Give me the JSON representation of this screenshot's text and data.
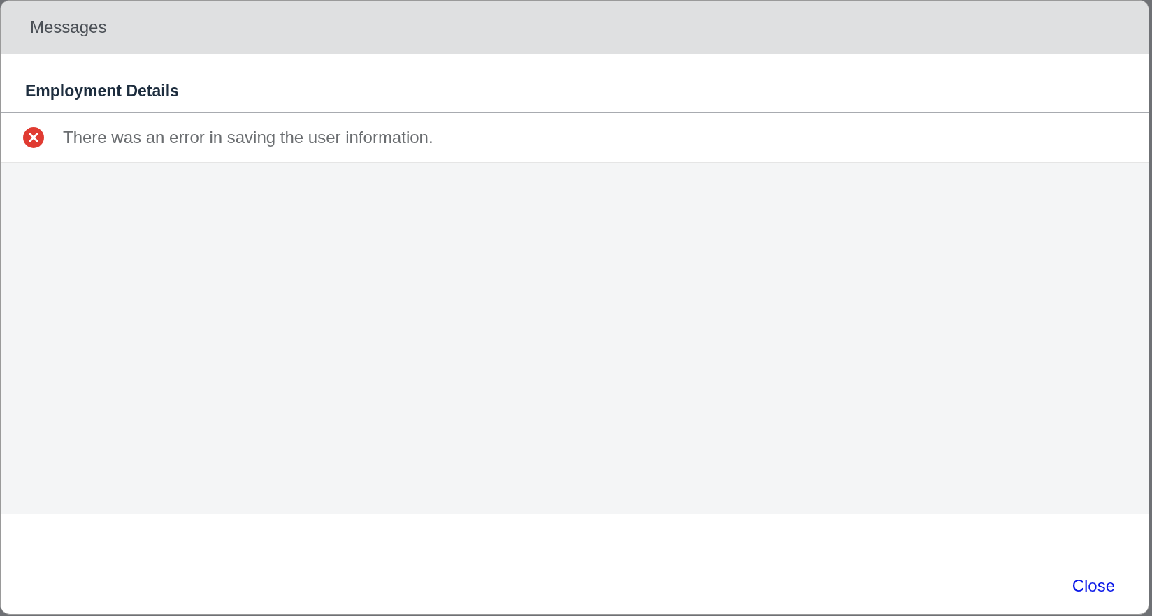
{
  "dialog": {
    "title": "Messages"
  },
  "group": {
    "title": "Employment Details"
  },
  "messages": [
    {
      "kind": "error",
      "text": "There was an error in saving the user information."
    }
  ],
  "footer": {
    "buttons": [
      "Close"
    ]
  }
}
